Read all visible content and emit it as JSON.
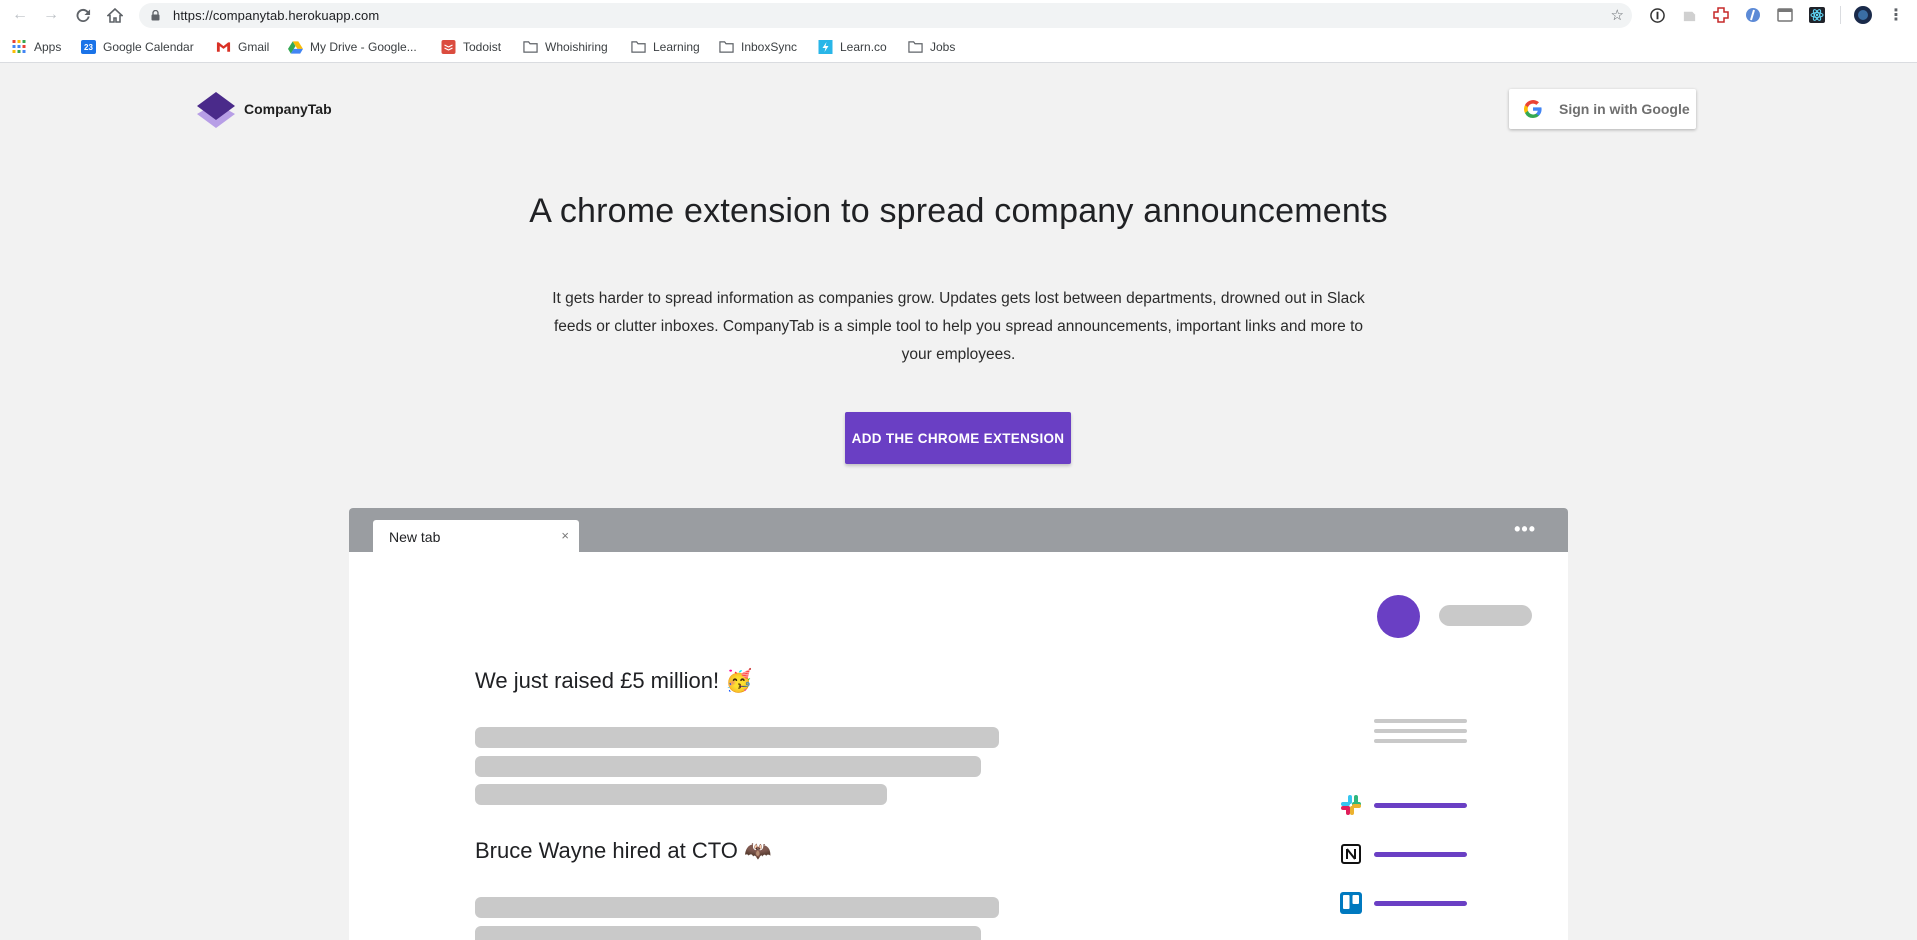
{
  "browser": {
    "url": "https://companytab.herokuapp.com",
    "bookmarks": [
      {
        "label": "Apps",
        "icon": "apps-grid-icon"
      },
      {
        "label": "Google Calendar",
        "icon": "calendar-icon"
      },
      {
        "label": "Gmail",
        "icon": "gmail-icon"
      },
      {
        "label": "My Drive - Google...",
        "icon": "drive-icon"
      },
      {
        "label": "Todoist",
        "icon": "todoist-icon"
      },
      {
        "label": "Whoishiring",
        "icon": "folder-icon"
      },
      {
        "label": "Learning",
        "icon": "folder-icon"
      },
      {
        "label": "InboxSync",
        "icon": "folder-icon"
      },
      {
        "label": "Learn.co",
        "icon": "learnco-icon"
      },
      {
        "label": "Jobs",
        "icon": "folder-icon"
      }
    ],
    "calendar_day": "23"
  },
  "header": {
    "brand": "CompanyTab",
    "signin_label": "Sign in with Google"
  },
  "hero": {
    "headline": "A chrome extension to spread company announcements",
    "description": "It gets harder to spread information as companies grow. Updates gets lost between departments, drowned out in Slack feeds or clutter inboxes. CompanyTab is a simple tool to help you spread announcements, important links and more to your employees.",
    "cta_label": "ADD THE CHROME EXTENSION"
  },
  "mockup": {
    "tab_title": "New tab",
    "tab_close": "×",
    "more": "•••",
    "announcements": [
      {
        "title": "We just raised £5 million!",
        "emoji": "🥳"
      },
      {
        "title": "Bruce Wayne hired at CTO",
        "emoji": "🦇"
      }
    ],
    "apps": [
      "slack-icon",
      "notion-icon",
      "trello-icon"
    ]
  },
  "colors": {
    "accent": "#6a3fc4",
    "page_bg": "#f2f2f2",
    "mock_bar": "#9a9da1",
    "skeleton": "#c9c9c9"
  }
}
